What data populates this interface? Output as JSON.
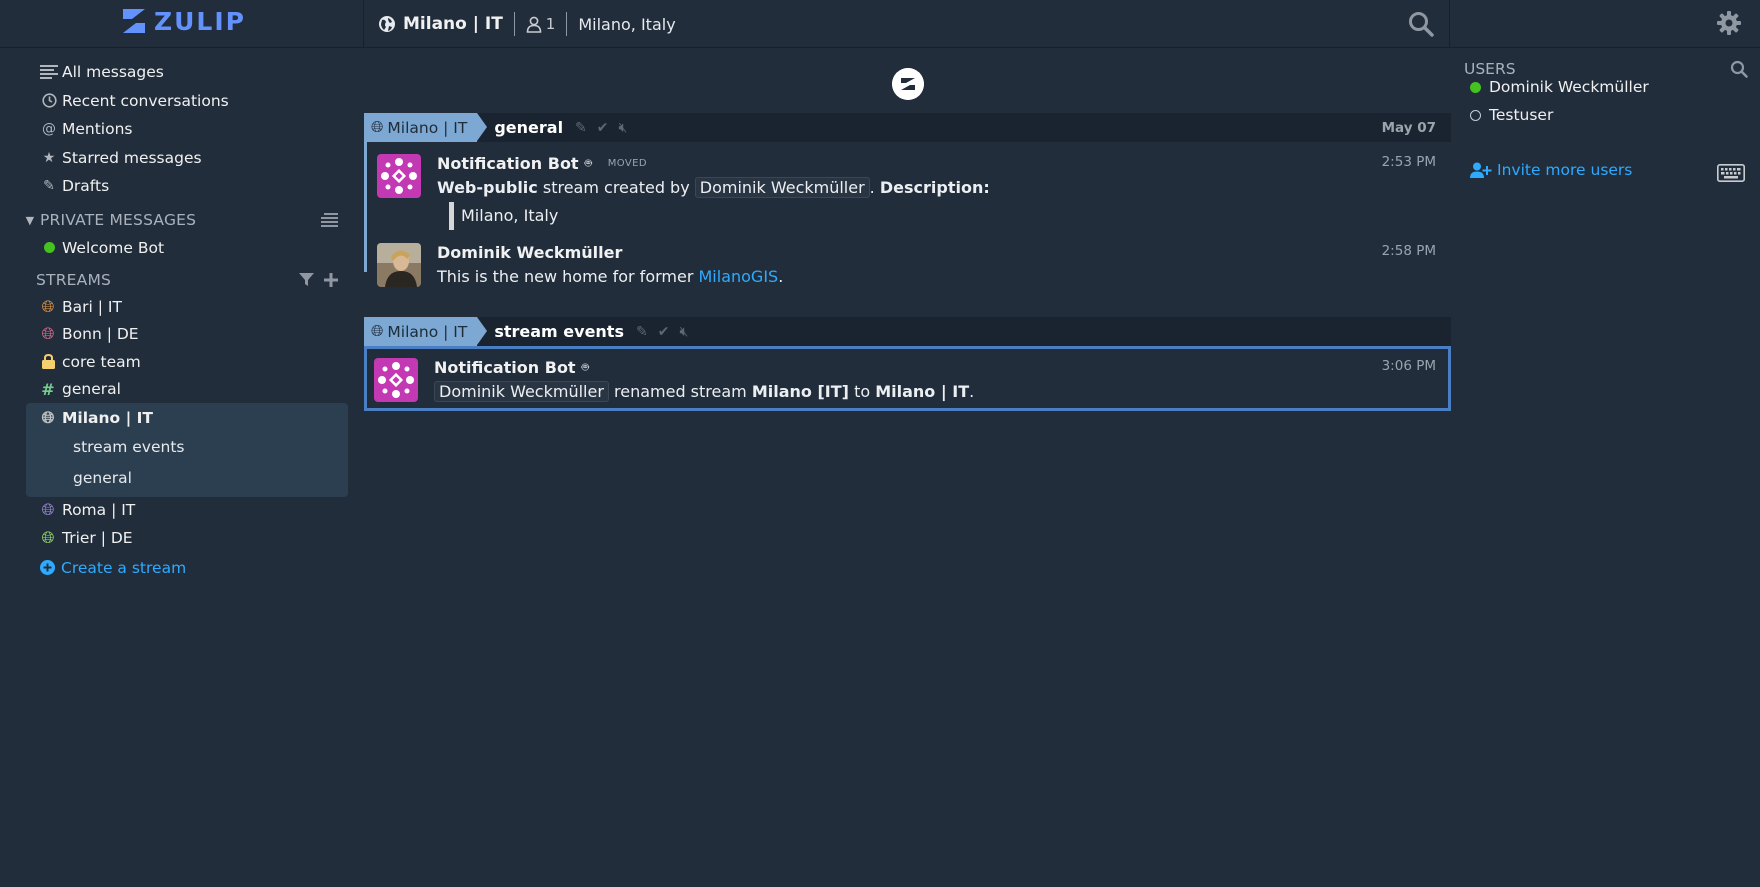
{
  "brand": {
    "name": "ZULIP",
    "color": "#6492fd"
  },
  "header": {
    "stream_name": "Milano | IT",
    "subscriber_count": "1",
    "description": "Milano, Italy"
  },
  "nav": {
    "items": [
      {
        "label": "All messages",
        "icon": "all-messages-icon"
      },
      {
        "label": "Recent conversations",
        "icon": "clock-icon"
      },
      {
        "label": "Mentions",
        "icon": "at-icon"
      },
      {
        "label": "Starred messages",
        "icon": "star-icon"
      },
      {
        "label": "Drafts",
        "icon": "pencil-icon"
      }
    ]
  },
  "private_messages": {
    "title": "PRIVATE MESSAGES",
    "items": [
      {
        "label": "Welcome Bot",
        "status_color": "#44c21d"
      }
    ]
  },
  "streams": {
    "title": "STREAMS",
    "items": [
      {
        "label": "Bari | IT",
        "color": "#e79a4a"
      },
      {
        "label": "Bonn | DE",
        "color": "#e87093"
      },
      {
        "label": "core team",
        "color": "#f5ce6e"
      },
      {
        "label": "general",
        "color": "#76ce90"
      },
      {
        "label": "Milano | IT",
        "color": "#c2c2c2"
      },
      {
        "label": "Roma | IT",
        "color": "#a18fe3"
      },
      {
        "label": "Trier | DE",
        "color": "#9fe870"
      }
    ],
    "active_topics": [
      "stream events",
      "general"
    ],
    "create_label": "Create a stream"
  },
  "feed": {
    "groups": [
      {
        "stream": "Milano | IT",
        "topic": "general",
        "date": "May 07",
        "messages": [
          {
            "sender": "Notification Bot",
            "badge": "MOVED",
            "time": "2:53 PM",
            "parts": {
              "p1_bold": "Web-public",
              "p1_text": " stream created by ",
              "p1_mention": "Dominik Weckmüller",
              "p1_tail": ". ",
              "p1_bold2": "Description:",
              "quote": "Milano, Italy"
            }
          },
          {
            "sender": "Dominik Weckmüller",
            "time": "2:58 PM",
            "parts": {
              "text": "This is the new home for former ",
              "link": "MilanoGIS",
              "tail": "."
            }
          }
        ]
      },
      {
        "stream": "Milano | IT",
        "topic": "stream events",
        "messages": [
          {
            "sender": "Notification Bot",
            "time": "3:06 PM",
            "parts": {
              "mention": "Dominik Weckmüller",
              "text1": " renamed stream ",
              "old": "Milano [IT]",
              "text2": " to ",
              "new": "Milano | IT",
              "tail": "."
            }
          }
        ]
      }
    ]
  },
  "users": {
    "title": "USERS",
    "items": [
      {
        "label": "Dominik Weckmüller",
        "status": "active"
      },
      {
        "label": "Testuser",
        "status": "offline"
      }
    ],
    "invite_label": "Invite more users"
  }
}
